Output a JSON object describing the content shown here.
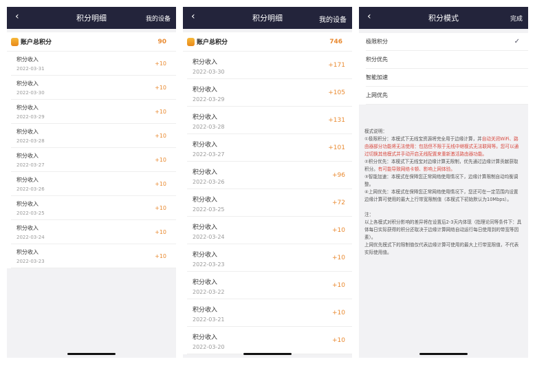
{
  "panel1": {
    "title": "积分明细",
    "back_icon": "‹",
    "right": "我的设备",
    "total_label": "账户总积分",
    "total_value": "90",
    "rows": [
      {
        "label": "积分收入",
        "date": "2022-03-31",
        "value": "+10"
      },
      {
        "label": "积分收入",
        "date": "2022-03-30",
        "value": "+10"
      },
      {
        "label": "积分收入",
        "date": "2022-03-29",
        "value": "+10"
      },
      {
        "label": "积分收入",
        "date": "2022-03-28",
        "value": "+10"
      },
      {
        "label": "积分收入",
        "date": "2022-03-27",
        "value": "+10"
      },
      {
        "label": "积分收入",
        "date": "2022-03-26",
        "value": "+10"
      },
      {
        "label": "积分收入",
        "date": "2022-03-25",
        "value": "+10"
      },
      {
        "label": "积分收入",
        "date": "2022-03-24",
        "value": "+10"
      },
      {
        "label": "积分收入",
        "date": "2022-03-23",
        "value": "+10"
      }
    ]
  },
  "panel2": {
    "title": "积分明细",
    "back_icon": "‹",
    "right": "我的设备",
    "total_label": "账户总积分",
    "total_value": "746",
    "rows": [
      {
        "label": "积分收入",
        "date": "2022-03-30",
        "value": "+171"
      },
      {
        "label": "积分收入",
        "date": "2022-03-29",
        "value": "+105"
      },
      {
        "label": "积分收入",
        "date": "2022-03-28",
        "value": "+131"
      },
      {
        "label": "积分收入",
        "date": "2022-03-27",
        "value": "+101"
      },
      {
        "label": "积分收入",
        "date": "2022-03-26",
        "value": "+96"
      },
      {
        "label": "积分收入",
        "date": "2022-03-25",
        "value": "+72"
      },
      {
        "label": "积分收入",
        "date": "2022-03-24",
        "value": "+10"
      },
      {
        "label": "积分收入",
        "date": "2022-03-23",
        "value": "+10"
      },
      {
        "label": "积分收入",
        "date": "2022-03-22",
        "value": "+10"
      },
      {
        "label": "积分收入",
        "date": "2022-03-21",
        "value": "+10"
      },
      {
        "label": "积分收入",
        "date": "2022-03-20",
        "value": "+10"
      }
    ]
  },
  "panel3": {
    "title": "积分模式",
    "back_icon": "‹",
    "right": "完成",
    "check_icon": "✓",
    "modes": [
      "极限积分",
      "积分优先",
      "智能加速",
      "上网优先"
    ],
    "selected": 0,
    "desc": {
      "heading": "模式说明：",
      "m1a": "①极限积分：本模式下无线宝资源将完全用于边缘计算，并",
      "m1b": "自动关闭WiFi、路由器部分功能将无法使用：包括但不限于无线中继模式无法联网等。您可以通过切换其他模式并手动开启无线配置来重新激活路由器功能。",
      "m2a": "②积分优先：本模式下无线宝对边缘计算无限制，优先通过边缘计算贡献获取积分。",
      "m2b": "有可能导致网络卡顿、影响上网体验。",
      "m3": "③智能加速：本模式在保障您正常网络使用情况下，边缘计算限制自动均衡调整。",
      "m4": "④上网优先：本模式在保障您正常网络使用情况下，您还可在一定范围内设置边缘计算可使用的最大上行带宽限制值（本模式下初始默认为10Mbps）。",
      "note_heading": "注：",
      "note1": "以上各模式对积分影响的差异将在设置后2-3天内体现（指理论同等条件下：具体每日实际获得的积分还取决于边缘计算网络自动运行每日使用到的带宽等因素）。",
      "note2": "上网优先模式下的限制值仅代表边缘计算可使用的最大上行带宽限值，不代表实际使用值。"
    }
  }
}
